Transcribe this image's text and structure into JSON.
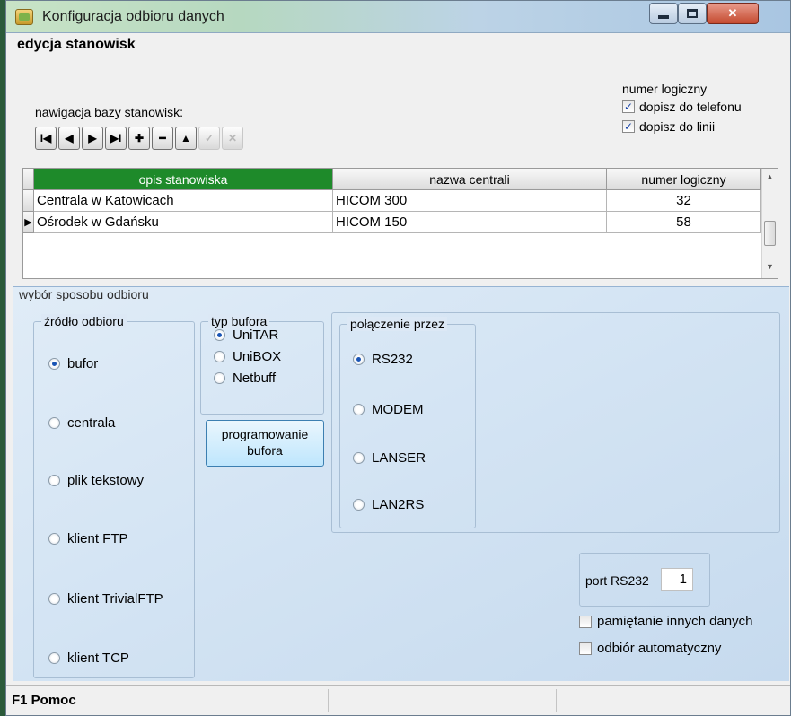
{
  "window": {
    "title": "Konfiguracja odbioru danych"
  },
  "section": {
    "title": "edycja stanowisk"
  },
  "navigation": {
    "label": "nawigacja bazy stanowisk:",
    "buttons": [
      {
        "glyph": "I◀"
      },
      {
        "glyph": "◀"
      },
      {
        "glyph": "▶"
      },
      {
        "glyph": "▶I"
      },
      {
        "glyph": "✚"
      },
      {
        "glyph": "━"
      },
      {
        "glyph": "▲"
      },
      {
        "glyph": "✓"
      },
      {
        "glyph": "✕"
      }
    ]
  },
  "numer_logiczny": {
    "title": "numer logiczny",
    "phone_label": "dopisz do telefonu",
    "phone_checked": true,
    "line_label": "dopisz do linii",
    "line_checked": true
  },
  "grid": {
    "columns": [
      "opis stanowiska",
      "nazwa centrali",
      "numer logiczny"
    ],
    "rows": [
      {
        "opis": "Centrala w Katowicach",
        "centrala": "HICOM 300",
        "numer": "32",
        "current": false
      },
      {
        "opis": "Ośrodek w Gdańsku",
        "centrala": "HICOM 150",
        "numer": "58",
        "current": true
      }
    ]
  },
  "wybor": {
    "title": "wybór sposobu odbioru",
    "zrodlo": {
      "title": "źródło odbioru",
      "options": [
        "bufor",
        "centrala",
        "plik tekstowy",
        "klient FTP",
        "klient TrivialFTP",
        "klient TCP"
      ],
      "selected": "bufor"
    },
    "typ_bufora": {
      "title": "typ bufora",
      "options": [
        "UniTAR",
        "UniBOX",
        "Netbuff"
      ],
      "selected": "UniTAR"
    },
    "polaczenie": {
      "title": "połączenie przez",
      "options": [
        "RS232",
        "MODEM",
        "LANSER",
        "LAN2RS"
      ],
      "selected": "RS232"
    },
    "prog_button_line1": "programowanie",
    "prog_button_line2": "bufora",
    "port_label": "port RS232",
    "port_value": "1",
    "pamietanie_label": "pamiętanie innych danych",
    "pamietanie_checked": false,
    "automatyczny_label": "odbiór automatyczny",
    "automatyczny_checked": false
  },
  "statusbar": {
    "text": "F1 Pomoc"
  }
}
